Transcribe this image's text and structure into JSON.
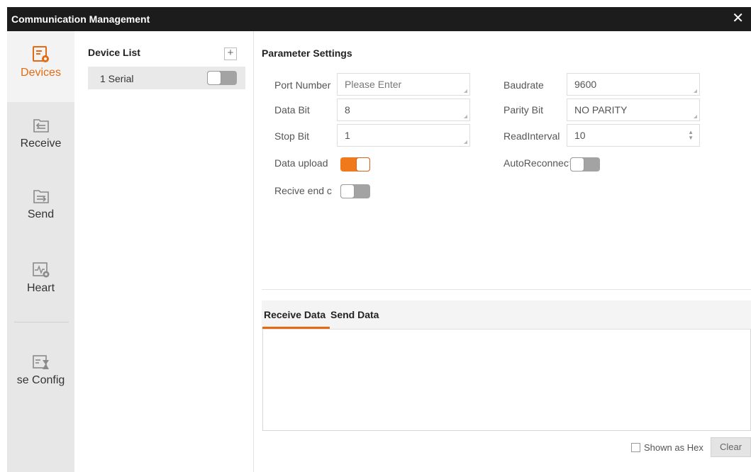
{
  "window": {
    "title": "Communication Management",
    "close_glyph": "✕"
  },
  "sidebar": {
    "items": [
      {
        "label": "Devices",
        "icon": "devices-icon",
        "active": true
      },
      {
        "label": "Receive",
        "icon": "receive-icon",
        "active": false
      },
      {
        "label": "Send",
        "icon": "send-icon",
        "active": false
      },
      {
        "label": "Heart",
        "icon": "heart-icon",
        "active": false
      },
      {
        "label": "se Config",
        "icon": "config-icon",
        "active": false
      }
    ]
  },
  "device_list": {
    "title": "Device List",
    "add_glyph": "+",
    "devices": [
      {
        "label": "1 Serial",
        "enabled": false
      }
    ]
  },
  "params": {
    "title": "Parameter Settings",
    "port_number": {
      "label": "Port Number",
      "placeholder": "Please Enter"
    },
    "baudrate": {
      "label": "Baudrate",
      "value": "9600"
    },
    "data_bit": {
      "label": "Data Bit",
      "value": "8"
    },
    "parity_bit": {
      "label": "Parity Bit",
      "value": "NO PARITY"
    },
    "stop_bit": {
      "label": "Stop Bit",
      "value": "1"
    },
    "read_interval": {
      "label": "ReadInterval",
      "value": "10"
    },
    "data_upload": {
      "label": "Data upload",
      "enabled": true
    },
    "auto_reconnect": {
      "label": "AutoReconnect",
      "enabled": false
    },
    "receive_end": {
      "label": "Recive end c",
      "enabled": false
    }
  },
  "data_tabs": {
    "tabs": [
      {
        "label": "Receive Data",
        "active": true
      },
      {
        "label": "Send Data",
        "active": false
      }
    ]
  },
  "footer": {
    "hex_label": "Shown as Hex",
    "hex_checked": false,
    "clear_label": "Clear"
  },
  "colors": {
    "accent": "#e46b12",
    "titlebar": "#1c1c1c",
    "sidebar": "#e7e7e7",
    "toggle_off": "#a3a3a3"
  }
}
